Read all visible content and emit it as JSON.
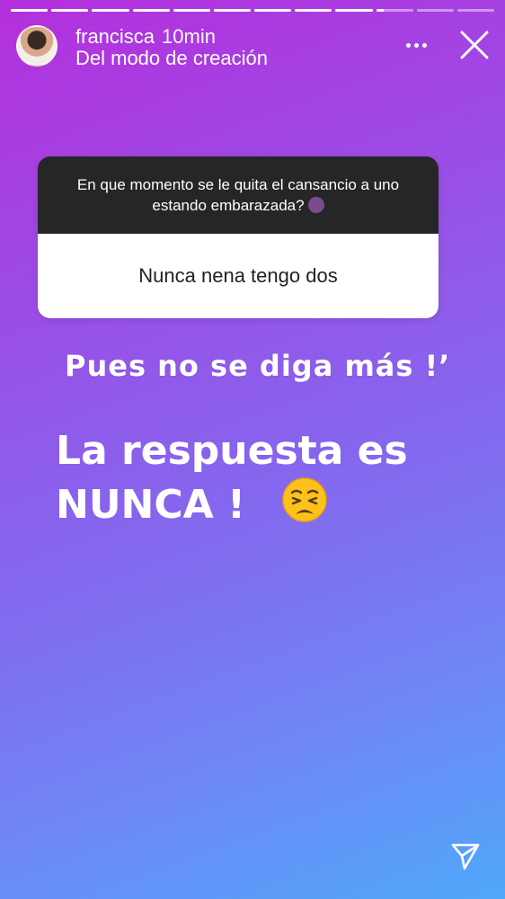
{
  "progress": {
    "segments_total": 12,
    "current_index": 9,
    "current_fraction": 0.2
  },
  "header": {
    "username": "francisca",
    "time": "10min",
    "subtitle": "Del modo de creación"
  },
  "question_card": {
    "question": "En que momento se le quita el cansancio a uno estando embarazada?",
    "answer": "Nunca nena tengo dos"
  },
  "caption_1": "Pues no se diga más !’",
  "caption_2_line1": "La respuesta es",
  "caption_2_line2": "NUNCA !",
  "icons": {
    "more": "more-dots-icon",
    "close": "close-icon",
    "send": "send-icon",
    "emoji_question": "face-palm-woman-emoji",
    "emoji_tired": "weary-face-emoji"
  },
  "colors": {
    "gradient_top": "#b52fdc",
    "gradient_bottom": "#50a8fb",
    "card_question_bg": "#262626",
    "card_answer_bg": "#ffffff"
  }
}
